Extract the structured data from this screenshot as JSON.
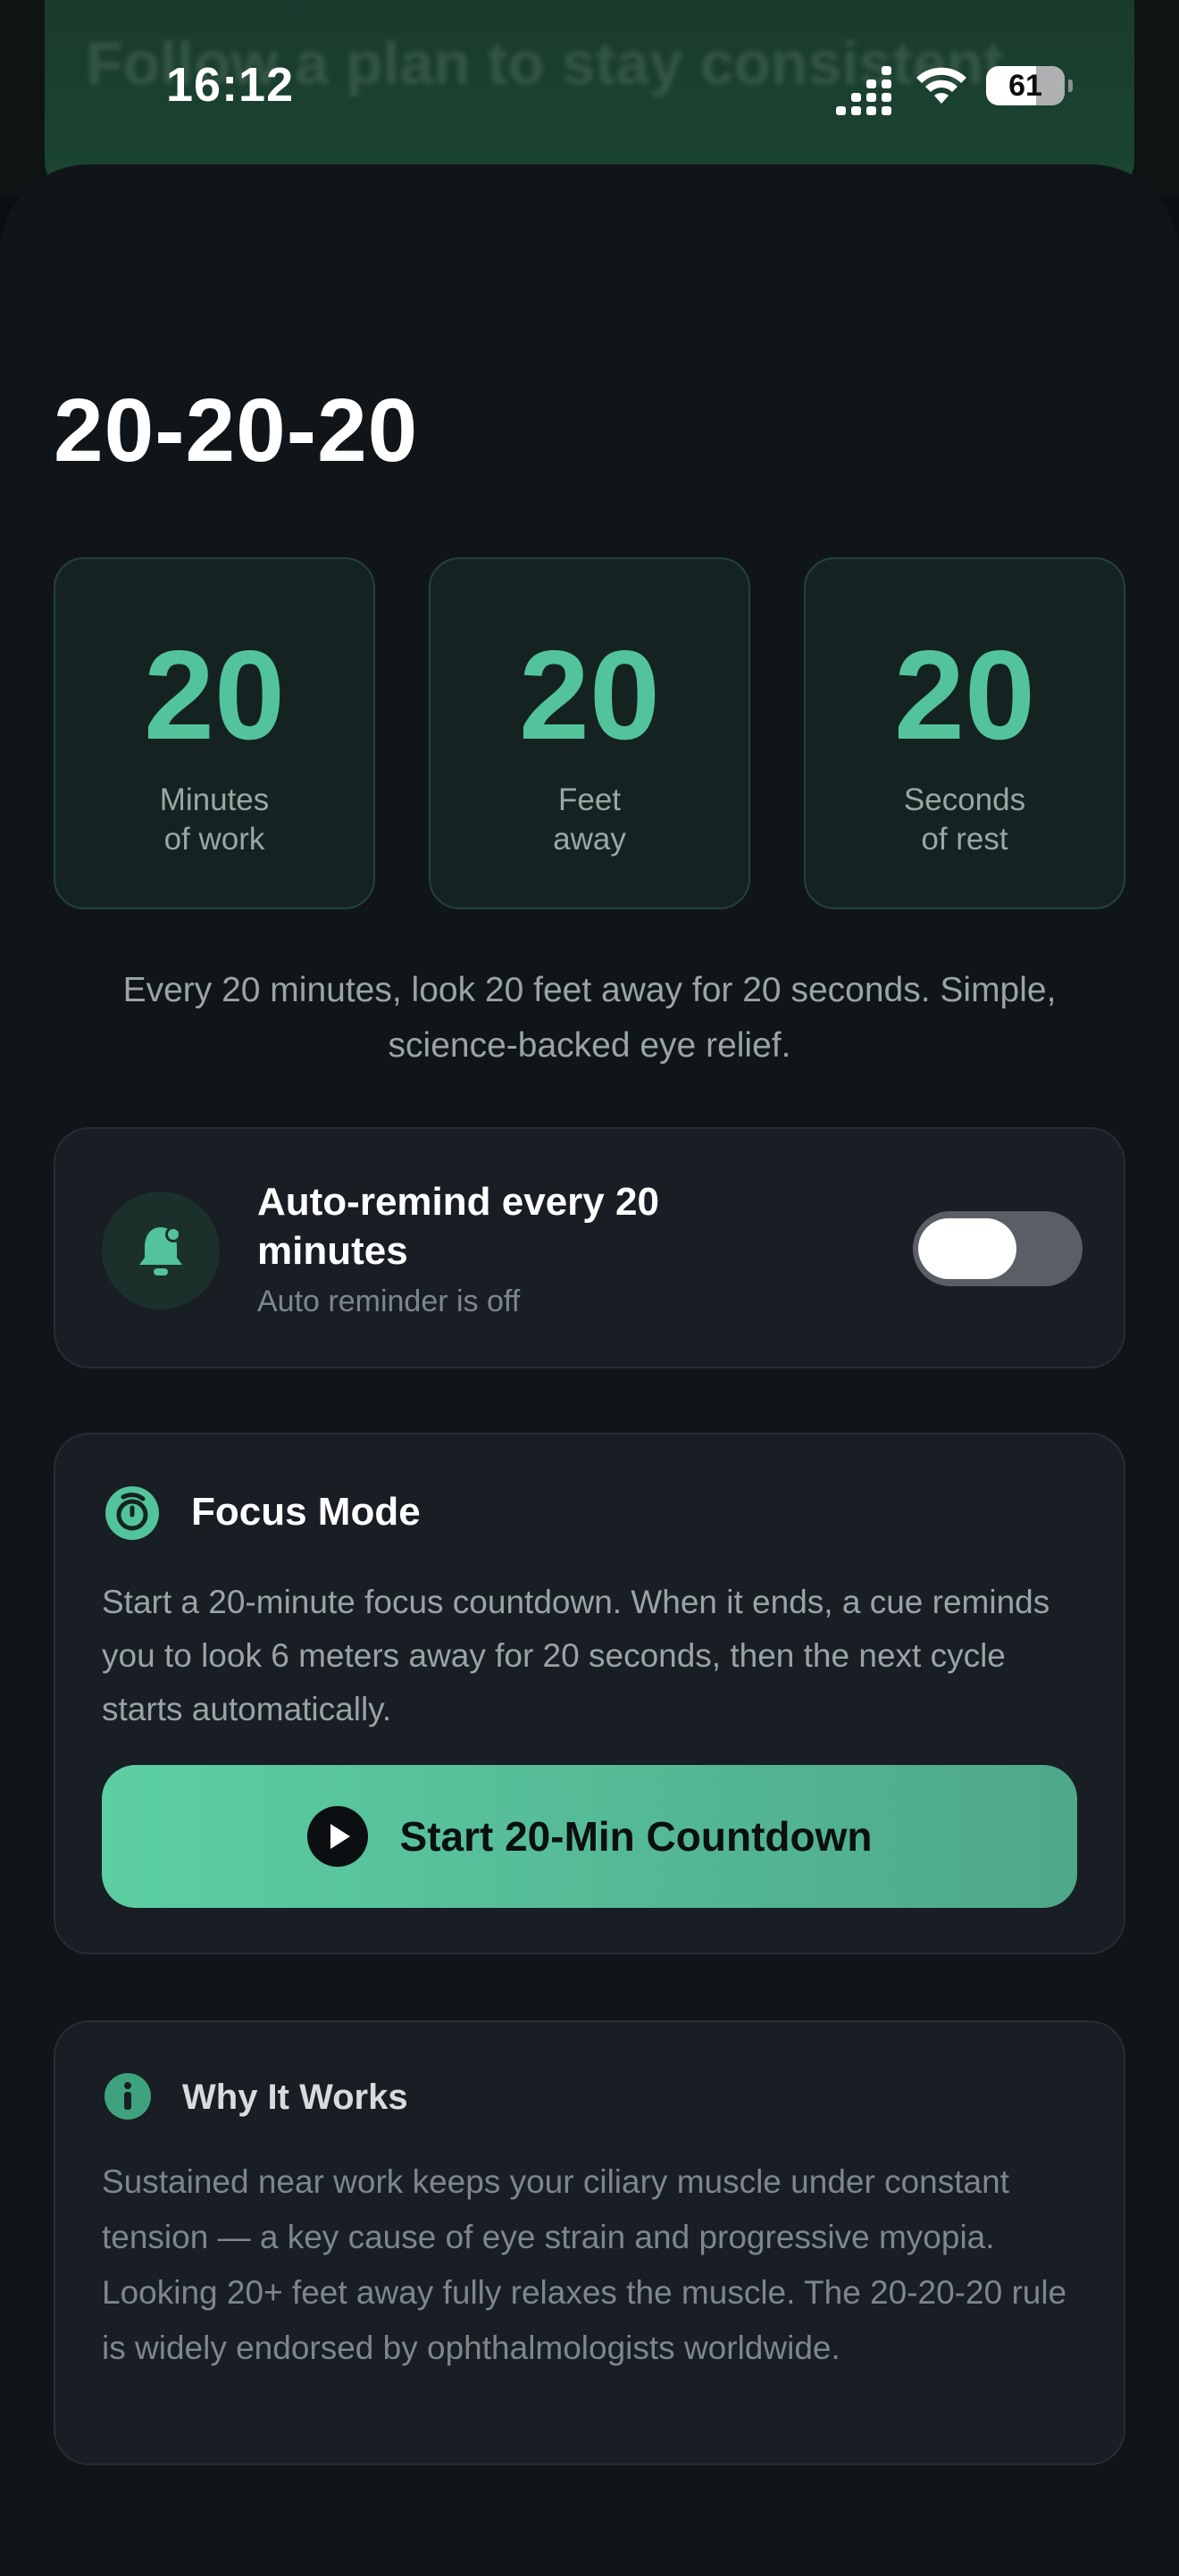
{
  "status_bar": {
    "time": "16:12",
    "battery_level": "61"
  },
  "backdrop": {
    "partial_text": "Follow a plan to stay consistent"
  },
  "screen": {
    "title": "20-20-20",
    "tiles": [
      {
        "number": "20",
        "label_line1": "Minutes",
        "label_line2": "of work"
      },
      {
        "number": "20",
        "label_line1": "Feet",
        "label_line2": "away"
      },
      {
        "number": "20",
        "label_line1": "Seconds",
        "label_line2": "of rest"
      }
    ],
    "description": "Every 20 minutes, look 20 feet away for 20 seconds. Simple, science-backed eye relief."
  },
  "auto_remind": {
    "title": "Auto-remind every 20 minutes",
    "subtitle": "Auto reminder is off",
    "toggle_on": false
  },
  "focus_mode": {
    "title": "Focus Mode",
    "body": "Start a 20-minute focus countdown. When it ends, a cue reminds you to look 6 meters away for 20 seconds, then the next cycle starts automatically.",
    "button_label": "Start 20-Min Countdown"
  },
  "why_it_works": {
    "title": "Why It Works",
    "body": "Sustained near work keeps your ciliary muscle under constant tension — a key cause of eye strain and progressive myopia. Looking 20+ feet away fully relaxes the muscle. The 20-20-20 rule is widely endorsed by ophthalmologists worldwide."
  },
  "colors": {
    "accent": "#53c39b",
    "background": "#10151a",
    "card": "#181e23",
    "button_start": "#5ccfa3",
    "button_end": "#4ea88a"
  },
  "icons": {
    "bell": "bell-icon",
    "focus": "timer-icon",
    "info": "info-icon",
    "play": "play-icon"
  }
}
